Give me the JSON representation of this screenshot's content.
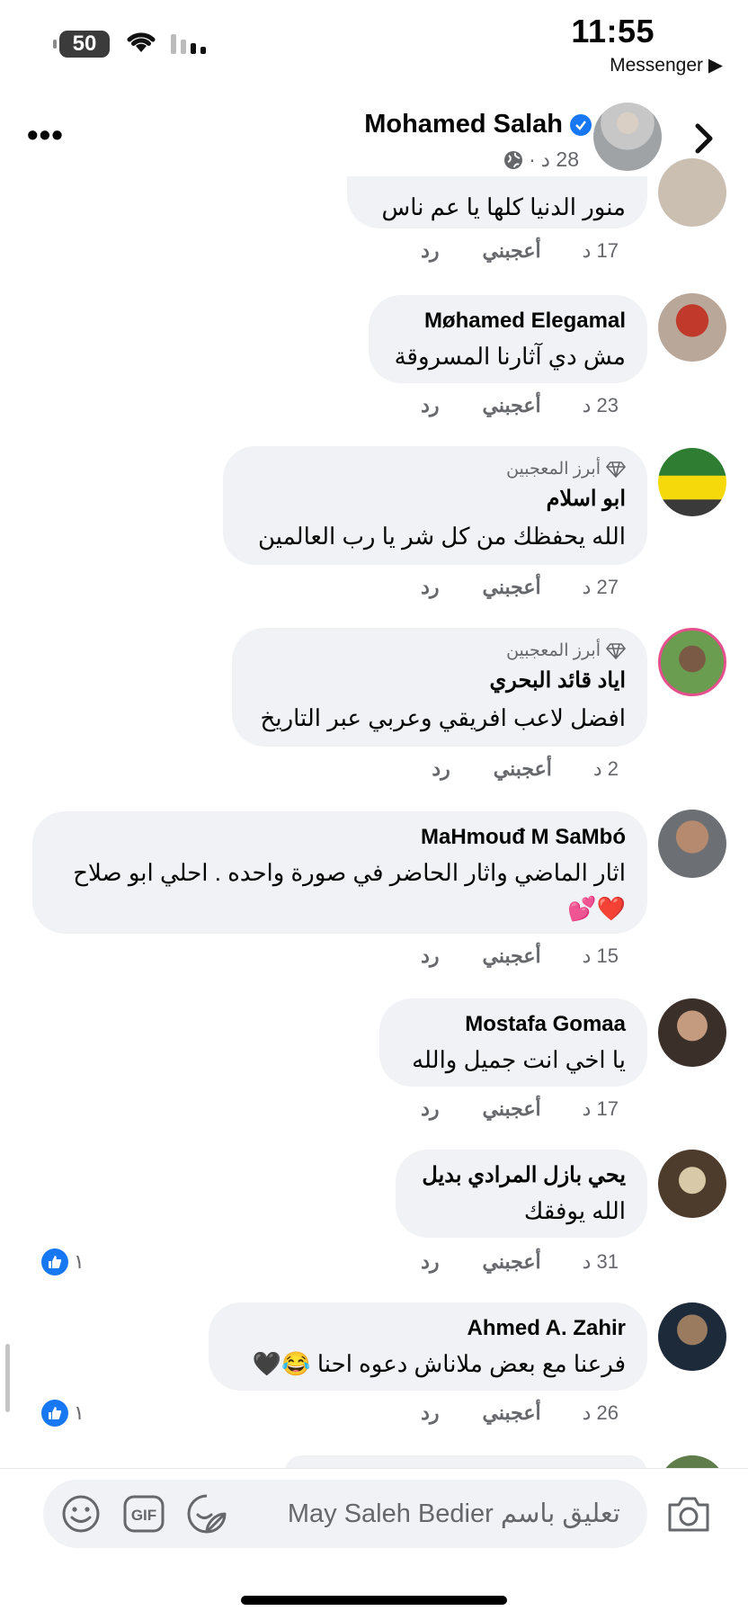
{
  "status": {
    "time": "11:55",
    "battery": "50",
    "back_app": "Messenger ▶"
  },
  "header": {
    "name": "Mohamed Salah",
    "meta_time": "28 د",
    "meta_sep": "·"
  },
  "comments": [
    {
      "name": "",
      "text": "منور الدنيا كلها يا عم ناس",
      "time": "17 د",
      "like": "أعجبني",
      "reply": "رد"
    },
    {
      "name": "Møhamed Elegamal",
      "text": "مش دي آثارنا المسروقة",
      "time": "23 د",
      "like": "أعجبني",
      "reply": "رد"
    },
    {
      "badge": "أبرز المعجبين",
      "name": "ابو اسلام",
      "text": "الله يحفظك من كل شر يا رب العالمين",
      "time": "27 د",
      "like": "أعجبني",
      "reply": "رد"
    },
    {
      "badge": "أبرز المعجبين",
      "name": "اياد قائد البحري",
      "text": "افضل لاعب افريقي وعربي عبر التاريخ",
      "time": "2 د",
      "like": "أعجبني",
      "reply": "رد"
    },
    {
      "name": "MaHmouđ M SaMbó",
      "text": "اثار الماضي واثار الحاضر في صورة واحده .  احلي ابو صلاح",
      "emoji": "❤️💕",
      "time": "15 د",
      "like": "أعجبني",
      "reply": "رد"
    },
    {
      "name": "Mostafa Gomaa",
      "text": "يا اخي انت جميل والله",
      "time": "17 د",
      "like": "أعجبني",
      "reply": "رد"
    },
    {
      "name": "يحي بازل المرادي بديل",
      "text": "الله يوفقك",
      "time": "31 د",
      "like": "أعجبني",
      "reply": "رد",
      "reactions": "١"
    },
    {
      "name": "Ahmed A. Zahir",
      "text": "فرعنا مع بعض ملاناش دعوه احنا 😂🖤",
      "time": "26 د",
      "like": "أعجبني",
      "reply": "رد",
      "reactions": "١"
    }
  ],
  "composer": {
    "placeholder": "تعليق باسم May Saleh Bedier",
    "gif_label": "GIF"
  },
  "colors": {
    "accent": "#1877f2",
    "bubble": "#f0f2f5",
    "muted": "#65676b"
  }
}
